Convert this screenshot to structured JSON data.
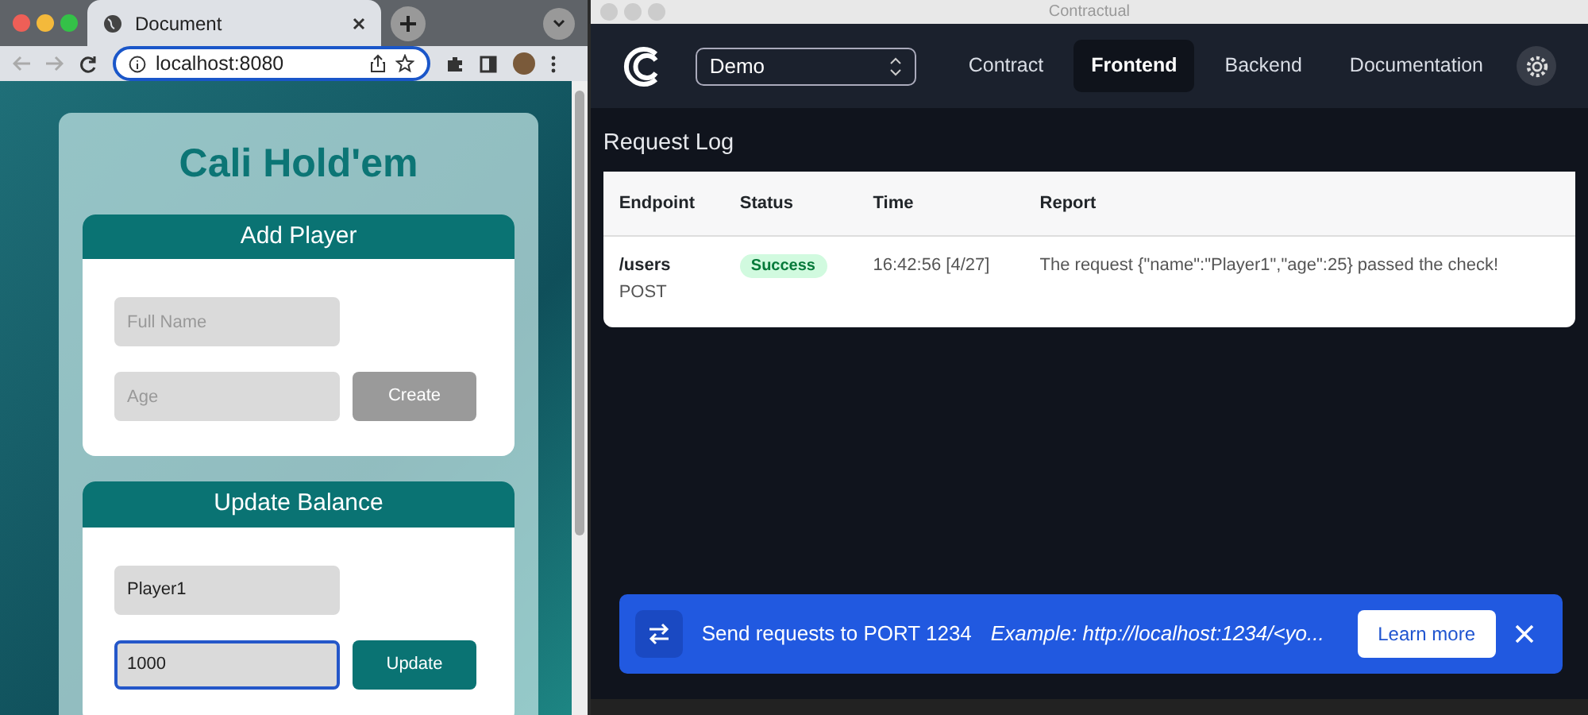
{
  "browser": {
    "tab_title": "Document",
    "url": "localhost:8080"
  },
  "app": {
    "heading": "Cali Hold'em",
    "sections": [
      {
        "title": "Add Player",
        "fields": [
          {
            "placeholder": "Full Name",
            "focused": false
          },
          {
            "placeholder": "Age",
            "focused": false
          }
        ],
        "button": {
          "label": "Create",
          "disabled": true
        }
      },
      {
        "title": "Update Balance",
        "fields": [
          {
            "value": "Player1",
            "focused": false
          },
          {
            "value": "1000",
            "focused": true
          }
        ],
        "button": {
          "label": "Update",
          "disabled": false
        }
      }
    ]
  },
  "window": {
    "title": "Contractual"
  },
  "project_select": "Demo",
  "nav": [
    {
      "label": "Contract",
      "selected": false
    },
    {
      "label": "Frontend",
      "selected": true
    },
    {
      "label": "Backend",
      "selected": false
    },
    {
      "label": "Documentation",
      "selected": false
    }
  ],
  "page_title": "Request Log",
  "table": {
    "columns": [
      "Endpoint",
      "Status",
      "Time",
      "Report"
    ],
    "rows": [
      {
        "endpoint": "/users",
        "method": "POST",
        "status": {
          "label": "Success",
          "kind": "success"
        },
        "time": "16:42:56 [4/27]",
        "report": "The request {\"name\":\"Player1\",\"age\":25} passed the check!"
      }
    ]
  },
  "banner": {
    "message": "Send requests to PORT 1234",
    "example": "Example: http://localhost:1234/<yo...",
    "button": "Learn more"
  }
}
